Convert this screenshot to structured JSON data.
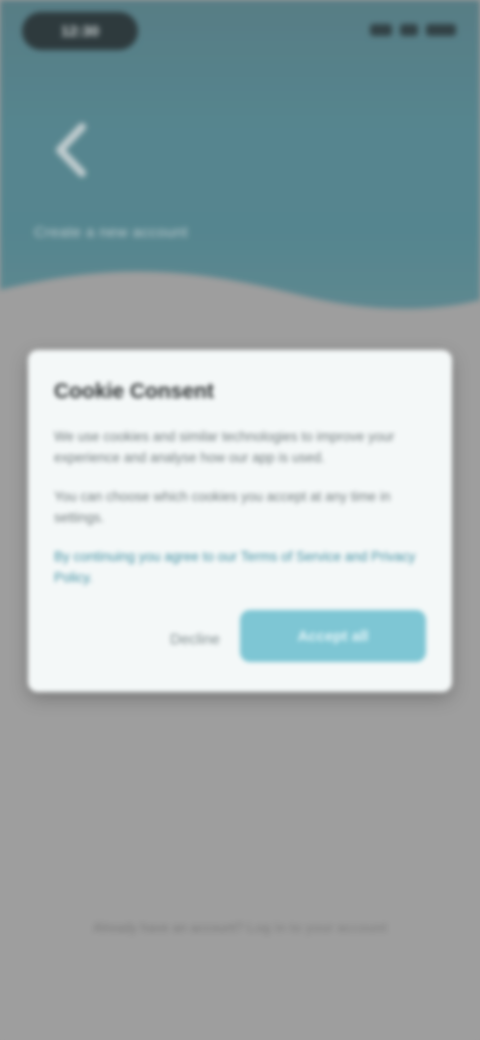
{
  "status_bar": {
    "time": "12:30"
  },
  "hero": {
    "title": "Create a new account"
  },
  "dialog": {
    "title": "Cookie Consent",
    "paragraphs": [
      "We use cookies and similar technologies to improve your experience and analyse how our app is used.",
      "You can choose which cookies you accept at any time in settings.",
      "By continuing you agree to our Terms of Service and Privacy Policy."
    ],
    "cancel_label": "Decline",
    "confirm_label": "Accept all"
  },
  "footer": {
    "prefix": "Already have an account?",
    "link": "Log in to your account"
  },
  "colors": {
    "accent": "#7ec6d4",
    "hero": "#4e8a96",
    "scrim": "#a9a9a9"
  }
}
